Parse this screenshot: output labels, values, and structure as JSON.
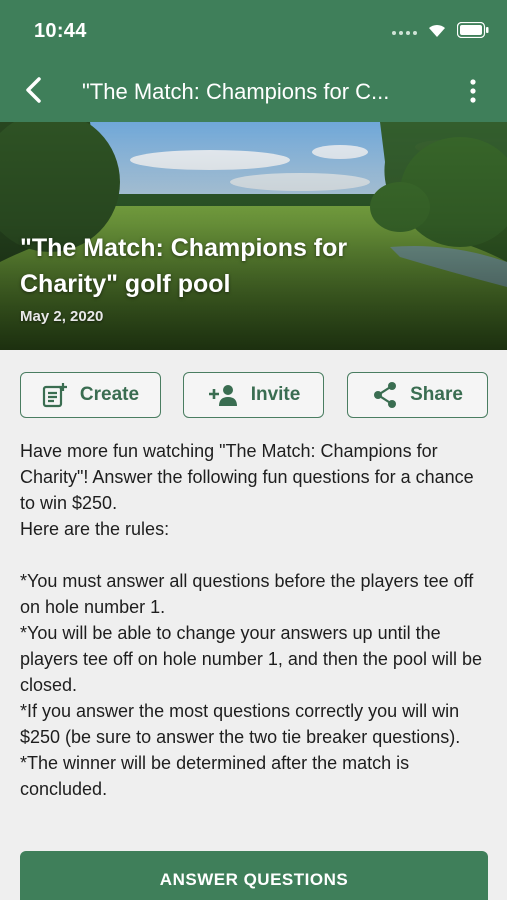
{
  "status_bar": {
    "time": "10:44"
  },
  "app_bar": {
    "title": "\"The Match: Champions for C..."
  },
  "hero": {
    "title": "\"The Match: Champions for Charity\" golf pool",
    "date": "May 2, 2020"
  },
  "actions": {
    "create_label": "Create",
    "invite_label": "Invite",
    "share_label": "Share"
  },
  "description": "Have more fun watching \"The Match: Champions for Charity\"! Answer the following fun questions for a chance to win $250.\nHere are the rules:\n\n*You must answer all questions before the players tee off on hole number 1.\n*You will be able to change your answers up until the players tee off on hole number 1, and then the pool will be closed.\n*If you answer the most questions correctly you will win $250 (be sure to answer the two tie breaker questions).\n*The winner will be determined after the match is concluded.",
  "cta": {
    "label": "ANSWER QUESTIONS"
  },
  "colors": {
    "primary": "#3f7f5a",
    "button_border": "#4a7d61",
    "background": "#efefef"
  },
  "icons": [
    "signal-icon",
    "wifi-icon",
    "battery-icon",
    "back-arrow-icon",
    "more-vert-icon",
    "create-post-icon",
    "add-person-icon",
    "share-icon"
  ]
}
